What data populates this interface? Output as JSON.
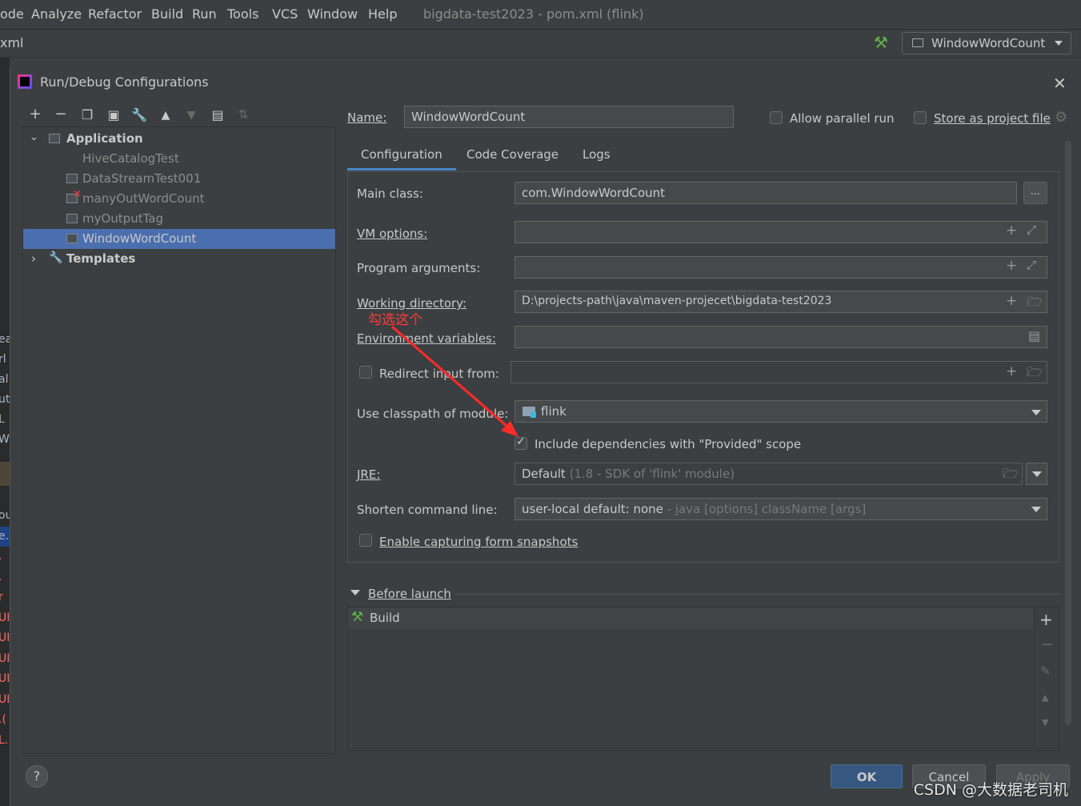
{
  "menubar": {
    "items": [
      "ode",
      "Analyze",
      "Refactor",
      "Build",
      "Run",
      "Tools",
      "VCS",
      "Window",
      "Help"
    ],
    "window_title": "bigdata-test2023 - pom.xml (flink)"
  },
  "toolbar": {
    "file_crumb": "xml",
    "run_config": "WindowWordCount"
  },
  "dialog": {
    "title": "Run/Debug Configurations",
    "tree": {
      "application": "Application",
      "items": [
        "HiveCatalogTest",
        "DataStreamTest001",
        "manyOutWordCount",
        "myOutputTag",
        "WindowWordCount"
      ],
      "templates": "Templates"
    },
    "name_label": "Name:",
    "name_value": "WindowWordCount",
    "allow_parallel": "Allow parallel run",
    "store_project": "Store as project file",
    "tabs": [
      "Configuration",
      "Code Coverage",
      "Logs"
    ],
    "form": {
      "main_class_label": "Main class:",
      "main_class_value": "com.WindowWordCount",
      "vm_options_label": "VM options:",
      "program_args_label": "Program arguments:",
      "working_dir_label": "Working directory:",
      "working_dir_value": "D:\\projects-path\\java\\maven-projecet\\bigdata-test2023",
      "env_vars_label": "Environment variables:",
      "redirect_label": "Redirect input from:",
      "classpath_label": "Use classpath of module:",
      "classpath_value": "flink",
      "include_deps_label": "Include dependencies with \"Provided\" scope",
      "jre_label": "JRE:",
      "jre_value": "Default",
      "jre_hint": "(1.8 - SDK of 'flink' module)",
      "shorten_label": "Shorten command line:",
      "shorten_value": "user-local default: none",
      "shorten_hint": "- java [options] className [args]",
      "snapshots_label": "Enable capturing form snapshots"
    },
    "before_launch": "Before launch",
    "build_task": "Build",
    "buttons": {
      "ok": "OK",
      "cancel": "Cancel",
      "apply": "Apply",
      "help": "?"
    }
  },
  "annotation": "勾选这个",
  "watermark": "CSDN @大数据老司机",
  "left_gutter_fragments": [
    "ea",
    "rl",
    "al",
    "ut",
    "L",
    "W",
    "ou",
    "e.",
    ".",
    ".",
    "r",
    "UI",
    "UI",
    "UI",
    "UI",
    "UI",
    ".(",
    "L."
  ]
}
